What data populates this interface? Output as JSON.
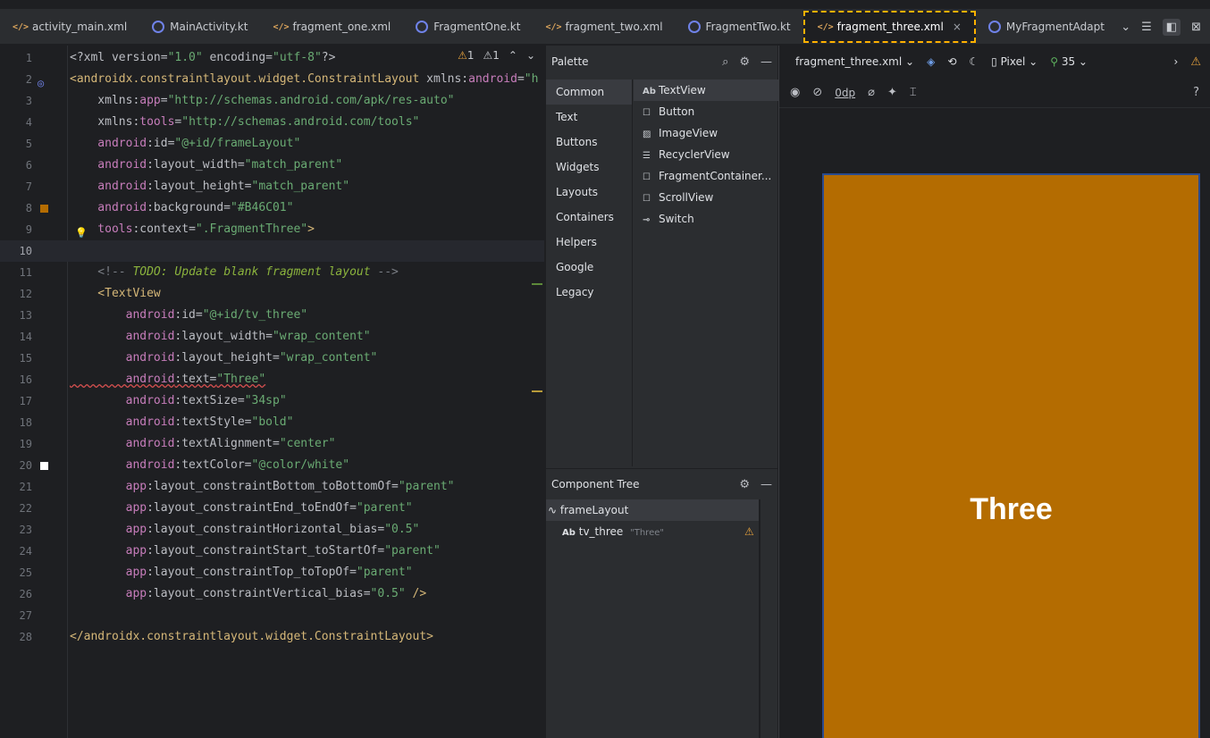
{
  "tabs": [
    {
      "label": "activity_main.xml",
      "type": "xml",
      "name": "tab-activity-main-xml"
    },
    {
      "label": "MainActivity.kt",
      "type": "kt",
      "name": "tab-mainactivity-kt"
    },
    {
      "label": "fragment_one.xml",
      "type": "xml",
      "name": "tab-fragment-one-xml"
    },
    {
      "label": "FragmentOne.kt",
      "type": "kt",
      "name": "tab-fragmentone-kt"
    },
    {
      "label": "fragment_two.xml",
      "type": "xml",
      "name": "tab-fragment-two-xml"
    },
    {
      "label": "FragmentTwo.kt",
      "type": "kt",
      "name": "tab-fragmenttwo-kt"
    },
    {
      "label": "fragment_three.xml",
      "type": "xml",
      "name": "tab-fragment-three-xml",
      "active": true
    },
    {
      "label": "MyFragmentAdapt",
      "type": "kt",
      "name": "tab-myfragmentadapter-kt"
    }
  ],
  "editor": {
    "warnings": [
      "1",
      "1"
    ],
    "line_numbers": [
      "1",
      "2",
      "3",
      "4",
      "5",
      "6",
      "7",
      "8",
      "9",
      "10",
      "11",
      "12",
      "13",
      "14",
      "15",
      "16",
      "17",
      "18",
      "19",
      "20",
      "21",
      "22",
      "23",
      "24",
      "25",
      "26",
      "27",
      "28"
    ],
    "current_line": 10,
    "lines": [
      [
        [
          "t-pi",
          "<?xml version="
        ],
        [
          "t-val",
          "\"1.0\""
        ],
        [
          "t-pi",
          " encoding="
        ],
        [
          "t-val",
          "\"utf-8\""
        ],
        [
          "t-pi",
          "?>"
        ]
      ],
      [
        [
          "t-tag",
          "<androidx.constraintlayout.widget.ConstraintLayout"
        ],
        [
          "t-attr",
          " xmlns:"
        ],
        [
          "t-ns",
          "android"
        ],
        [
          "t-attr",
          "="
        ],
        [
          "t-val",
          "\"h"
        ]
      ],
      [
        [
          "t-attr",
          "    xmlns:"
        ],
        [
          "t-ns",
          "app"
        ],
        [
          "t-attr",
          "="
        ],
        [
          "t-val",
          "\"http://schemas.android.com/apk/res-auto\""
        ]
      ],
      [
        [
          "t-attr",
          "    xmlns:"
        ],
        [
          "t-ns",
          "tools"
        ],
        [
          "t-attr",
          "="
        ],
        [
          "t-val",
          "\"http://schemas.android.com/tools\""
        ]
      ],
      [
        [
          "t-ns",
          "    android"
        ],
        [
          "t-attr",
          ":id="
        ],
        [
          "t-val",
          "\"@+id/frameLayout\""
        ]
      ],
      [
        [
          "t-ns",
          "    android"
        ],
        [
          "t-attr",
          ":layout_width="
        ],
        [
          "t-val",
          "\"match_parent\""
        ]
      ],
      [
        [
          "t-ns",
          "    android"
        ],
        [
          "t-attr",
          ":layout_height="
        ],
        [
          "t-val",
          "\"match_parent\""
        ]
      ],
      [
        [
          "t-ns",
          "    android"
        ],
        [
          "t-attr",
          ":background="
        ],
        [
          "t-val",
          "\"#B46C01\""
        ]
      ],
      [
        [
          "t-ns",
          "    tools"
        ],
        [
          "t-attr",
          ":context="
        ],
        [
          "t-val",
          "\".FragmentThree\""
        ],
        [
          "t-tag",
          ">"
        ]
      ],
      [
        [
          "t-attr",
          ""
        ]
      ],
      [
        [
          "t-com",
          "    <!-- "
        ],
        [
          "t-todo",
          "TODO: Update blank fragment layout"
        ],
        [
          "t-com",
          " -->"
        ]
      ],
      [
        [
          "t-tag",
          "    <TextView"
        ]
      ],
      [
        [
          "t-ns",
          "        android"
        ],
        [
          "t-attr",
          ":id="
        ],
        [
          "t-val",
          "\"@+id/tv_three\""
        ]
      ],
      [
        [
          "t-ns",
          "        android"
        ],
        [
          "t-attr",
          ":layout_width="
        ],
        [
          "t-val",
          "\"wrap_content\""
        ]
      ],
      [
        [
          "t-ns",
          "        android"
        ],
        [
          "t-attr",
          ":layout_height="
        ],
        [
          "t-val",
          "\"wrap_content\""
        ]
      ],
      [
        [
          "t-ns squig",
          "        android"
        ],
        [
          "t-attr squig",
          ":text="
        ],
        [
          "t-val squig",
          "\"Three\""
        ]
      ],
      [
        [
          "t-ns",
          "        android"
        ],
        [
          "t-attr",
          ":textSize="
        ],
        [
          "t-val",
          "\"34sp\""
        ]
      ],
      [
        [
          "t-ns",
          "        android"
        ],
        [
          "t-attr",
          ":textStyle="
        ],
        [
          "t-val",
          "\"bold\""
        ]
      ],
      [
        [
          "t-ns",
          "        android"
        ],
        [
          "t-attr",
          ":textAlignment="
        ],
        [
          "t-val",
          "\"center\""
        ]
      ],
      [
        [
          "t-ns",
          "        android"
        ],
        [
          "t-attr",
          ":textColor="
        ],
        [
          "t-val",
          "\"@color/white\""
        ]
      ],
      [
        [
          "t-ns",
          "        app"
        ],
        [
          "t-attr",
          ":layout_constraintBottom_toBottomOf="
        ],
        [
          "t-val",
          "\"parent\""
        ]
      ],
      [
        [
          "t-ns",
          "        app"
        ],
        [
          "t-attr",
          ":layout_constraintEnd_toEndOf="
        ],
        [
          "t-val",
          "\"parent\""
        ]
      ],
      [
        [
          "t-ns",
          "        app"
        ],
        [
          "t-attr",
          ":layout_constraintHorizontal_bias="
        ],
        [
          "t-val",
          "\"0.5\""
        ]
      ],
      [
        [
          "t-ns",
          "        app"
        ],
        [
          "t-attr",
          ":layout_constraintStart_toStartOf="
        ],
        [
          "t-val",
          "\"parent\""
        ]
      ],
      [
        [
          "t-ns",
          "        app"
        ],
        [
          "t-attr",
          ":layout_constraintTop_toTopOf="
        ],
        [
          "t-val",
          "\"parent\""
        ]
      ],
      [
        [
          "t-ns",
          "        app"
        ],
        [
          "t-attr",
          ":layout_constraintVertical_bias="
        ],
        [
          "t-val",
          "\"0.5\""
        ],
        [
          "t-tag",
          " />"
        ]
      ],
      [
        [
          "t-attr",
          ""
        ]
      ],
      [
        [
          "t-tag",
          "</androidx.constraintlayout.widget.ConstraintLayout>"
        ]
      ]
    ],
    "gutter_colors": {
      "line8": "#B46C01",
      "line20": "#FFFFFF"
    }
  },
  "palette": {
    "title": "Palette",
    "categories": [
      "Common",
      "Text",
      "Buttons",
      "Widgets",
      "Layouts",
      "Containers",
      "Helpers",
      "Google",
      "Legacy"
    ],
    "selected_category": "Common",
    "items": [
      {
        "icon": "Ab",
        "label": "TextView"
      },
      {
        "icon": "☐",
        "label": "Button"
      },
      {
        "icon": "▨",
        "label": "ImageView"
      },
      {
        "icon": "☰",
        "label": "RecyclerView"
      },
      {
        "icon": "☐",
        "label": "FragmentContainer..."
      },
      {
        "icon": "☐",
        "label": "ScrollView"
      },
      {
        "icon": "⊸",
        "label": "Switch"
      }
    ]
  },
  "component_tree": {
    "title": "Component Tree",
    "root": "frameLayout",
    "child_prefix": "Ab",
    "child": "tv_three",
    "child_hint": "\"Three\""
  },
  "design": {
    "file": "fragment_three.xml",
    "device": "Pixel",
    "api": "35",
    "offset": "0dp",
    "preview_text": "Three",
    "preview_bg": "#B46C01"
  }
}
